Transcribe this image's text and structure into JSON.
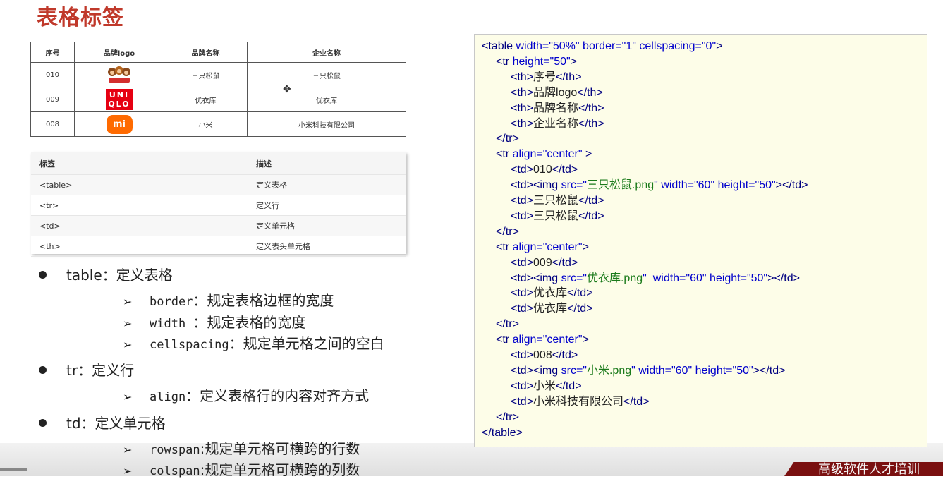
{
  "title": "表格标签",
  "brand_table": {
    "headers": [
      "序号",
      "品牌logo",
      "品牌名称",
      "企业名称"
    ],
    "rows": [
      {
        "id": "010",
        "logo": "三只松鼠-logo",
        "brand": "三只松鼠",
        "company": "三只松鼠"
      },
      {
        "id": "009",
        "logo": "uniqlo-logo",
        "logo_text": [
          "UNI",
          "QLO"
        ],
        "brand": "优衣库",
        "company": "优衣库"
      },
      {
        "id": "008",
        "logo": "xiaomi-logo",
        "logo_text": "mi",
        "brand": "小米",
        "company": "小米科技有限公司"
      }
    ]
  },
  "tag_table": {
    "headers": [
      "标签",
      "描述"
    ],
    "rows": [
      {
        "tag": "<table>",
        "desc": "定义表格"
      },
      {
        "tag": "<tr>",
        "desc": "定义行"
      },
      {
        "tag": "<td>",
        "desc": "定义单元格"
      },
      {
        "tag": "<th>",
        "desc": "定义表头单元格"
      }
    ]
  },
  "bullets": [
    {
      "label": "table：定义表格",
      "subs": [
        {
          "key": "border",
          "text": "：规定表格边框的宽度"
        },
        {
          "key": "width ",
          "text": "：规定表格的宽度"
        },
        {
          "key": "cellspacing",
          "text": "：规定单元格之间的空白"
        }
      ]
    },
    {
      "label": "tr：定义行",
      "subs": [
        {
          "key": "align",
          "text": "：定义表格行的内容对齐方式"
        }
      ]
    },
    {
      "label": "td：定义单元格",
      "subs": [
        {
          "key": "rowspan",
          "text": ":规定单元格可横跨的行数"
        },
        {
          "key": "colspan",
          "text": ":规定单元格可横跨的列数"
        }
      ]
    }
  ],
  "code_lines": [
    "<table width=\"50%\" border=\"1\" cellspacing=\"0\">",
    "<tr height=\"50\">",
    "<th>序号</th>",
    "<th>品牌logo</th>",
    "<th>品牌名称</th>",
    "<th>企业名称</th>",
    "</tr>",
    "<tr align=\"center\" >",
    "<td>010</td>",
    "<td><img src=\"三只松鼠.png\" width=\"60\" height=\"50\"></td>",
    "<td>三只松鼠</td>",
    "<td>三只松鼠</td>",
    "</tr>",
    "<tr align=\"center\">",
    "<td>009</td>",
    "<td><img src=\"优衣库.png\"  width=\"60\" height=\"50\"></td>",
    "<td>优衣库</td>",
    "<td>优衣库</td>",
    "</tr>",
    "<tr align=\"center\">",
    "<td>008</td>",
    "<td><img src=\"小米.png\" width=\"60\" height=\"50\"></td>",
    "<td>小米</td>",
    "<td>小米科技有限公司</td>",
    "</tr>",
    "</table>"
  ],
  "footer": "高级软件人才培训",
  "colors": {
    "title": "#c0392b",
    "code_bg": "#fdfde8",
    "code_tag": "#000080",
    "code_attr": "#0000cc",
    "code_value": "#1a7a1a",
    "footer_bg": "#7a1010"
  }
}
